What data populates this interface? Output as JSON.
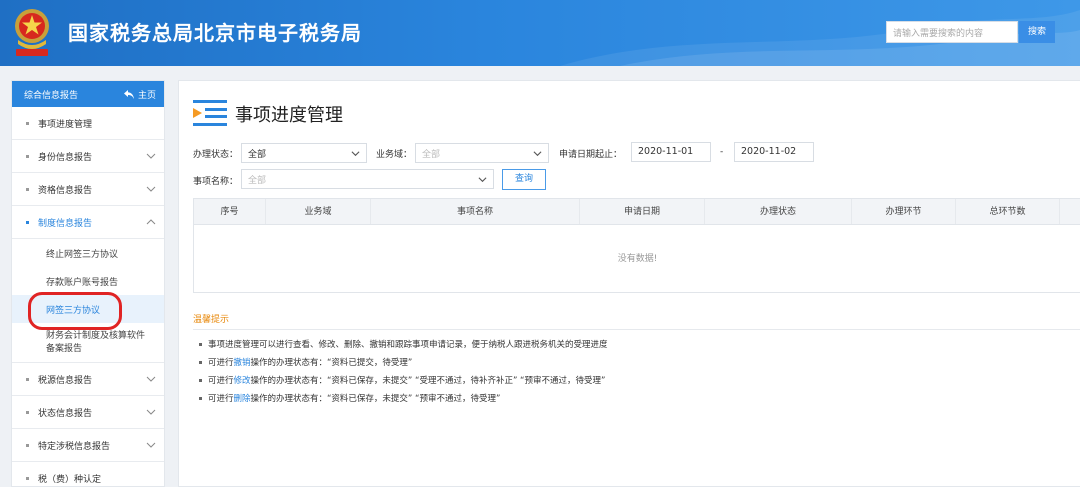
{
  "header": {
    "site_title": "国家税务总局北京市电子税务局",
    "search_placeholder": "请输入需要搜索的内容",
    "search_button": "搜索",
    "brand_color": "#2a85dd"
  },
  "sidebar": {
    "section_title": "综合信息报告",
    "home_label": "主页",
    "items": [
      {
        "label": "事项进度管理",
        "has_chevron": false
      },
      {
        "label": "身份信息报告",
        "has_chevron": true
      },
      {
        "label": "资格信息报告",
        "has_chevron": true
      },
      {
        "label": "制度信息报告",
        "has_chevron": true,
        "expanded": true
      }
    ],
    "sub_items": [
      {
        "label": "终止网签三方协议"
      },
      {
        "label": "存款账户账号报告"
      },
      {
        "label": "网签三方协议",
        "current": true
      },
      {
        "label": "财务会计制度及核算软件备案报告"
      }
    ],
    "items_after": [
      {
        "label": "税源信息报告"
      },
      {
        "label": "状态信息报告"
      },
      {
        "label": "特定涉税信息报告"
      },
      {
        "label": "税（费）种认定"
      }
    ]
  },
  "main": {
    "page_title": "事项进度管理",
    "filters": {
      "status_label": "办理状态：",
      "status_value": "全部",
      "domain_label": "业务域：",
      "domain_placeholder": "全部",
      "date_label": "申请日期起止：",
      "date_from": "2020-11-01",
      "date_sep": "-",
      "date_to": "2020-11-02",
      "item_label": "事项名称：",
      "item_placeholder": "全部",
      "query_button": "查询"
    },
    "table": {
      "columns": [
        "序号",
        "业务域",
        "事项名称",
        "申请日期",
        "办理状态",
        "办理环节",
        "总环节数"
      ],
      "empty_text": "没有数据!"
    },
    "tips": {
      "title": "温馨提示",
      "line1": "事项进度管理可以进行查看、修改、删除、撤销和跟踪事项申请记录，便于纳税人跟进税务机关的受理进度",
      "line2_pre": "可进行",
      "line2_hl": "撤销",
      "line2_post": "操作的办理状态有：“资料已提交，待受理”",
      "line3_pre": "可进行",
      "line3_hl": "修改",
      "line3_post": "操作的办理状态有：“资料已保存，未提交”  “受理不通过，待补齐补正”  “预审不通过，待受理”",
      "line4_pre": "可进行",
      "line4_hl": "删除",
      "line4_post": "操作的办理状态有：“资料已保存，未提交”  “预审不通过，待受理”"
    }
  }
}
